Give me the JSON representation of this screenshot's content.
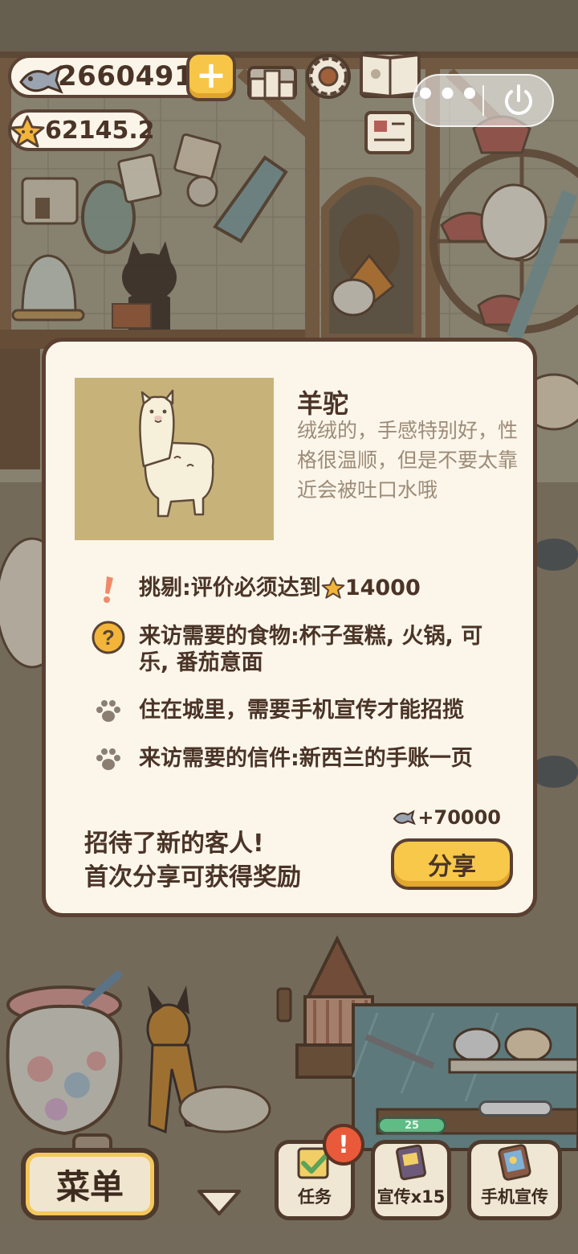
{
  "hud": {
    "coins": "2660491",
    "stars": "62145.2"
  },
  "mini_program": {
    "more_label": "•••"
  },
  "customer": {
    "name": "羊驼",
    "description": "绒绒的，手感特别好，性格很温顺，但是不要太靠近会被吐口水哦",
    "requirements": [
      {
        "icon": "exclamation-icon",
        "prefix": "挑剔:评价必须达到",
        "value": "14000"
      },
      {
        "icon": "question-icon",
        "text": "来访需要的食物:杯子蛋糕, 火锅, 可乐, 番茄意面"
      },
      {
        "icon": "paw-icon",
        "text": "住在城里，需要手机宣传才能招揽"
      },
      {
        "icon": "paw-icon",
        "text": "来访需要的信件:新西兰的手账一页"
      }
    ]
  },
  "share": {
    "reward": "+70000",
    "message_line1": "招待了新的客人!",
    "message_line2": "首次分享可获得奖励",
    "button_label": "分享"
  },
  "bottom_bar": {
    "menu_label": "菜单",
    "task_label": "任务",
    "task_badge": "!",
    "promo_label": "宣传x15",
    "promo_timer": "25",
    "phone_promo_label": "手机宣传"
  },
  "colors": {
    "accent_yellow": "#f8c84b",
    "outline_brown": "#5b4032",
    "panel_cream": "#fcf6ea",
    "portrait_bg": "#c7b37a"
  }
}
